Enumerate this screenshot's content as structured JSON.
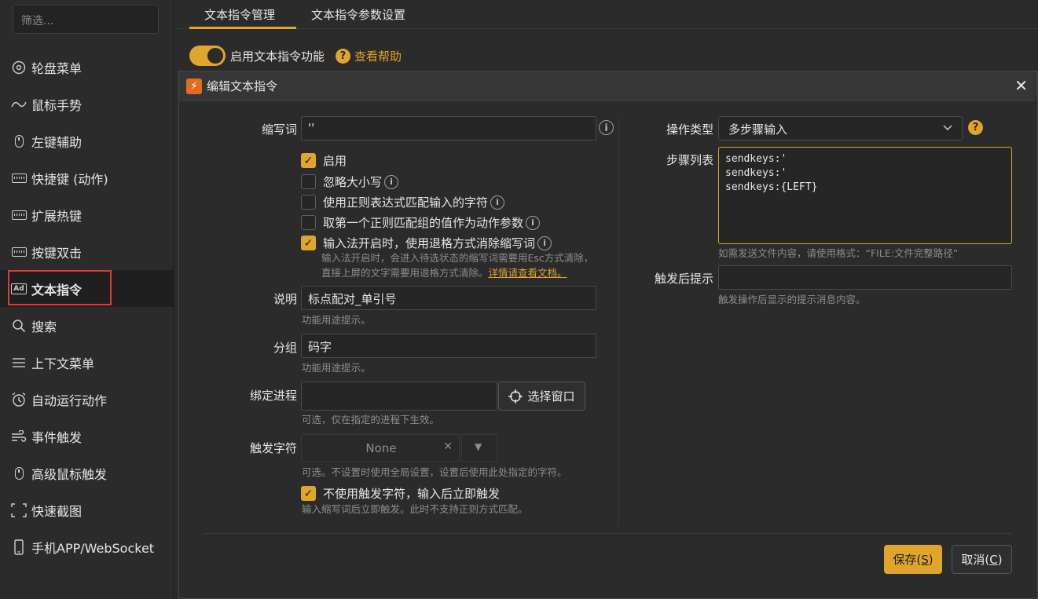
{
  "sidebar": {
    "filter_placeholder": "筛选...",
    "items": [
      {
        "label": "轮盘菜单",
        "icon": "wheel-icon"
      },
      {
        "label": "鼠标手势",
        "icon": "gesture-icon"
      },
      {
        "label": "左键辅助",
        "icon": "mouse-icon"
      },
      {
        "label": "快捷键 (动作)",
        "icon": "keyboard-icon"
      },
      {
        "label": "扩展热键",
        "icon": "keyboard-icon"
      },
      {
        "label": "按键双击",
        "icon": "keyboard-icon"
      },
      {
        "label": "文本指令",
        "icon": "ad-icon",
        "active": true
      },
      {
        "label": "搜索",
        "icon": "search-icon"
      },
      {
        "label": "上下文菜单",
        "icon": "menu-icon"
      },
      {
        "label": "自动运行动作",
        "icon": "alarm-icon"
      },
      {
        "label": "事件触发",
        "icon": "wind-icon"
      },
      {
        "label": "高级鼠标触发",
        "icon": "mouse-icon"
      },
      {
        "label": "快速截图",
        "icon": "screenshot-icon"
      },
      {
        "label": "手机APP/WebSocket",
        "icon": "phone-icon"
      }
    ]
  },
  "tabs": [
    {
      "label": "文本指令管理",
      "active": true
    },
    {
      "label": "文本指令参数设置",
      "active": false
    }
  ],
  "toolbar": {
    "enable_label": "启用文本指令功能",
    "enabled": true,
    "help_link": "查看帮助",
    "help_glyph": "?"
  },
  "dialog": {
    "title": "编辑文本指令",
    "close_glyph": "✕",
    "logo_glyph": "⚡",
    "info_glyph": "i",
    "abbrev": {
      "label": "缩写词",
      "value": "''"
    },
    "checkboxes": {
      "enable": {
        "label": "启用",
        "checked": true
      },
      "ignore_case": {
        "label": "忽略大小写",
        "checked": false
      },
      "regex": {
        "label": "使用正则表达式匹配输入的字符",
        "checked": false
      },
      "first_group": {
        "label": "取第一个正则匹配组的值作为动作参数",
        "checked": false
      },
      "ime": {
        "label": "输入法开启时，使用退格方式消除缩写词",
        "checked": true
      }
    },
    "ime_hint_line1": "输入法开启时，会进入待选状态的缩写词需要用Esc方式清除，",
    "ime_hint_line2": "直接上屏的文字需要用退格方式清除。",
    "ime_hint_link": "详情请查看文档。",
    "desc": {
      "label": "说明",
      "value": "标点配对_单引号",
      "hint": "功能用途提示。"
    },
    "group": {
      "label": "分组",
      "value": "码字",
      "hint": "功能用途提示。"
    },
    "process": {
      "label": "绑定进程",
      "value": "",
      "hint": "可选，仅在指定的进程下生效。",
      "select_window": "选择窗口"
    },
    "trigger_char": {
      "label": "触发字符",
      "value": "None",
      "hint": "可选。不设置时使用全局设置，设置后使用此处指定的字符。",
      "clear_glyph": "✕",
      "drop_glyph": "▼"
    },
    "no_trigger": {
      "label": "不使用触发字符，输入后立即触发",
      "checked": true,
      "hint": "输入缩写词后立即触发。此时不支持正则方式匹配。"
    },
    "action_type": {
      "label": "操作类型",
      "value": "多步骤输入"
    },
    "steps": {
      "label": "步骤列表",
      "value": "sendkeys:'\nsendkeys:'\nsendkeys:{LEFT}",
      "hint": "如需发送文件内容，请使用格式：“FILE:文件完整路径”"
    },
    "after_tip": {
      "label": "触发后提示",
      "value": "",
      "hint": "触发操作后显示的提示消息内容。"
    },
    "save_label": "保存(",
    "save_key": "S",
    "save_end": ")",
    "cancel_label": "取消(",
    "cancel_key": "C",
    "cancel_end": ")"
  },
  "colors": {
    "accent": "#e0a52b",
    "highlight_border": "#e53935",
    "logo": "#e36c1c"
  }
}
